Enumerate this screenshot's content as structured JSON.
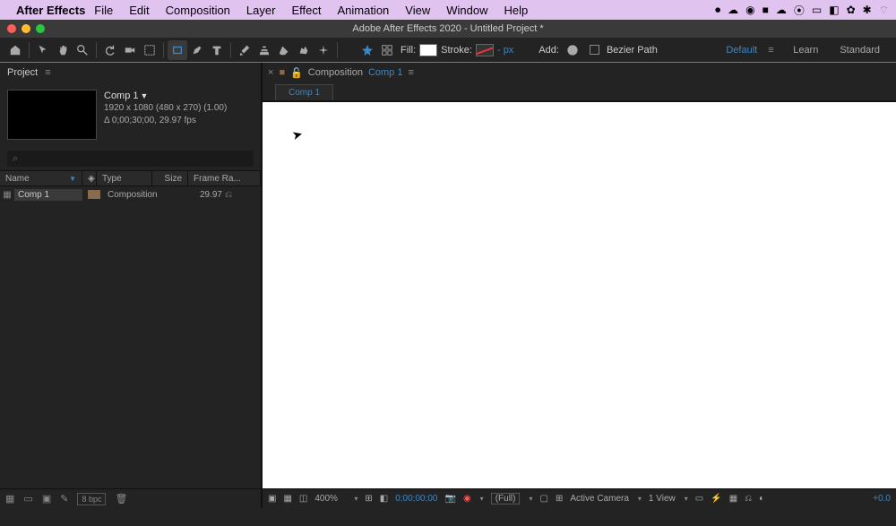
{
  "macmenu": {
    "app": "After Effects",
    "items": [
      "File",
      "Edit",
      "Composition",
      "Layer",
      "Effect",
      "Animation",
      "View",
      "Window",
      "Help"
    ]
  },
  "titlebar": {
    "title": "Adobe After Effects 2020 - Untitled Project *"
  },
  "toolbar": {
    "fill_label": "Fill:",
    "stroke_label": "Stroke:",
    "stroke_px": "- px",
    "add_label": "Add:",
    "bezier_label": "Bezier Path",
    "workspaces": {
      "default": "Default",
      "learn": "Learn",
      "standard": "Standard"
    }
  },
  "project": {
    "title": "Project",
    "comp": {
      "name": "Comp 1",
      "dims": "1920 x 1080  (480 x 270) (1.00)",
      "time": "Δ 0;00;30;00, 29.97 fps"
    },
    "cols": {
      "name": "Name",
      "type": "Type",
      "size": "Size",
      "fr": "Frame Ra..."
    },
    "items": [
      {
        "name": "Comp 1",
        "type": "Composition",
        "fr": "29.97"
      }
    ],
    "footer": {
      "bpc": "8 bpc"
    }
  },
  "viewer": {
    "hdr_prefix": "Composition",
    "hdr_name": "Comp 1",
    "tab": "Comp 1",
    "footer": {
      "zoom": "400%",
      "tc": "0;00;00;00",
      "res": "(Full)",
      "cam": "Active Camera",
      "view": "1 View",
      "expo": "+0.0"
    }
  }
}
